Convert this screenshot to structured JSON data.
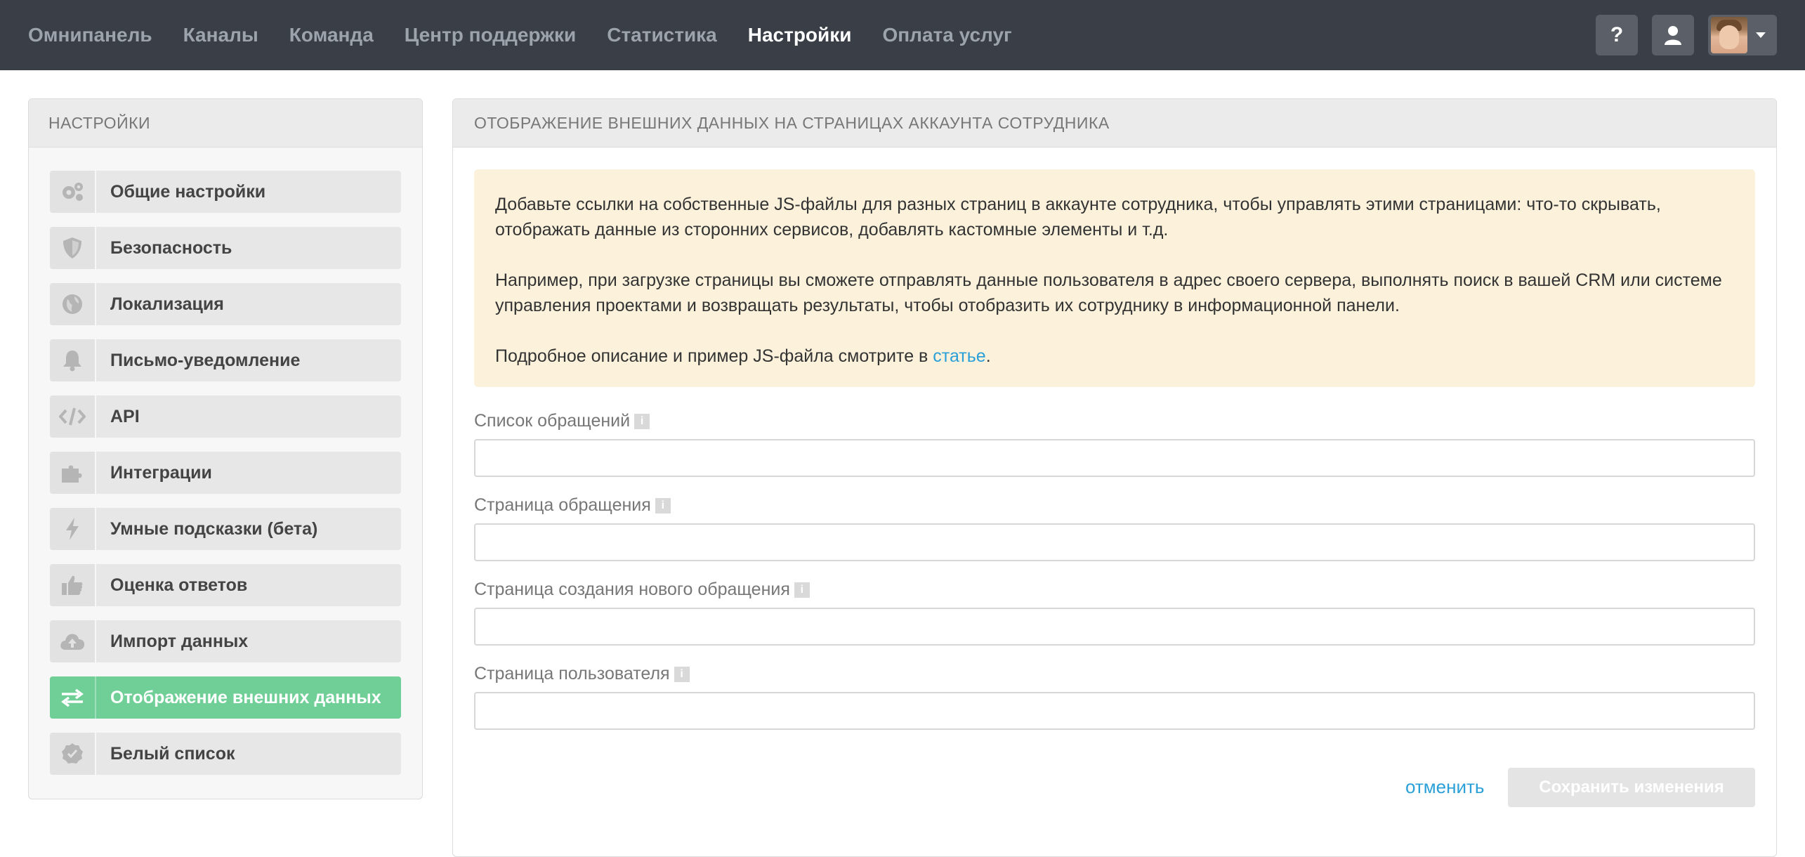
{
  "nav": {
    "items": [
      {
        "label": "Омнипанель",
        "active": false
      },
      {
        "label": "Каналы",
        "active": false
      },
      {
        "label": "Команда",
        "active": false
      },
      {
        "label": "Центр поддержки",
        "active": false
      },
      {
        "label": "Статистика",
        "active": false
      },
      {
        "label": "Настройки",
        "active": true
      },
      {
        "label": "Оплата услуг",
        "active": false
      }
    ],
    "help_label": "?",
    "user_icon": "user-icon"
  },
  "sidebar": {
    "title": "НАСТРОЙКИ",
    "items": [
      {
        "label": "Общие настройки",
        "icon": "gears-icon"
      },
      {
        "label": "Безопасность",
        "icon": "shield-icon"
      },
      {
        "label": "Локализация",
        "icon": "globe-icon"
      },
      {
        "label": "Письмо-уведомление",
        "icon": "bell-icon"
      },
      {
        "label": "API",
        "icon": "code-icon"
      },
      {
        "label": "Интеграции",
        "icon": "puzzle-icon"
      },
      {
        "label": "Умные подсказки (бета)",
        "icon": "bolt-icon"
      },
      {
        "label": "Оценка ответов",
        "icon": "thumbs-up-icon"
      },
      {
        "label": "Импорт данных",
        "icon": "cloud-upload-icon"
      },
      {
        "label": "Отображение внешних данных",
        "icon": "exchange-icon",
        "active": true
      },
      {
        "label": "Белый список",
        "icon": "check-badge-icon"
      }
    ]
  },
  "main": {
    "title": "ОТОБРАЖЕНИЕ ВНЕШНИХ ДАННЫХ НА СТРАНИЦАХ АККАУНТА СОТРУДНИКА",
    "notice": {
      "p1": "Добавьте ссылки на собственные JS-файлы для разных страниц в аккаунте сотрудника, чтобы управлять этими страницами: что-то скрывать, отображать данные из сторонних сервисов, добавлять кастомные элементы и т.д.",
      "p2": "Например, при загрузке страницы вы сможете отправлять данные пользователя в адрес своего сервера, выполнять поиск в вашей CRM или системе управления проектами и возвращать результаты, чтобы отобразить их сотруднику в информационной панели.",
      "p3_prefix": "Подробное описание и пример JS-файла смотрите в ",
      "p3_link": "статье",
      "p3_suffix": "."
    },
    "fields": [
      {
        "label": "Список обращений",
        "value": ""
      },
      {
        "label": "Страница обращения",
        "value": ""
      },
      {
        "label": "Страница создания нового обращения",
        "value": ""
      },
      {
        "label": "Страница пользователя",
        "value": ""
      }
    ],
    "cancel_label": "отменить",
    "save_label": "Сохранить изменения"
  },
  "colors": {
    "topbar": "#3a3f47",
    "active_green": "#6fcf97",
    "link_blue": "#2a9fd8",
    "notice_bg": "#fcf2dc"
  }
}
